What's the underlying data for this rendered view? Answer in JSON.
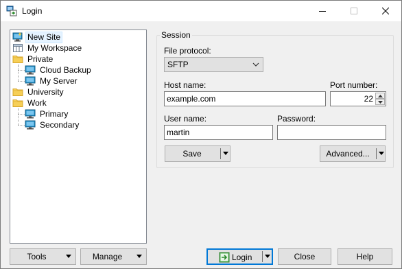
{
  "window": {
    "title": "Login",
    "icon": "winscp-login-icon"
  },
  "tree": {
    "items": [
      {
        "label": "New Site",
        "icon": "new-site-icon",
        "selected": true
      },
      {
        "label": "My Workspace",
        "icon": "workspace-icon"
      },
      {
        "label": "Private",
        "icon": "folder-icon"
      },
      {
        "label": "Cloud Backup",
        "icon": "computer-icon"
      },
      {
        "label": "My Server",
        "icon": "computer-icon"
      },
      {
        "label": "University",
        "icon": "folder-icon"
      },
      {
        "label": "Work",
        "icon": "folder-icon"
      },
      {
        "label": "Primary",
        "icon": "computer-icon"
      },
      {
        "label": "Secondary",
        "icon": "computer-icon"
      }
    ]
  },
  "session": {
    "group_label": "Session",
    "file_protocol_label": "File protocol:",
    "file_protocol_value": "SFTP",
    "host_name_label": "Host name:",
    "host_name_value": "example.com",
    "port_number_label": "Port number:",
    "port_number_value": "22",
    "user_name_label": "User name:",
    "user_name_value": "martin",
    "password_label": "Password:",
    "password_value": "",
    "save_label": "Save",
    "advanced_label": "Advanced..."
  },
  "footer": {
    "tools_label": "Tools",
    "manage_label": "Manage",
    "login_label": "Login",
    "close_label": "Close",
    "help_label": "Help"
  },
  "colors": {
    "accent": "#0078d7",
    "folder": "#e8b830",
    "computer": "#1e90c8"
  }
}
